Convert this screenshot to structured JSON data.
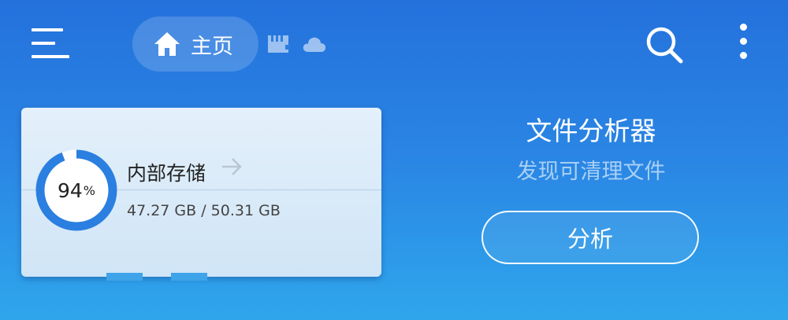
{
  "toolbar": {
    "menu_icon": "hamburger-menu-icon",
    "home_label": "主页",
    "home_icon": "home-icon",
    "storage_icon": "sd-card-icon",
    "cloud_icon": "cloud-icon",
    "search_icon": "search-icon",
    "more_icon": "more-vertical-icon"
  },
  "storage": {
    "percent": "94",
    "percent_unit": "%",
    "used_fraction": 0.94,
    "title": "内部存储",
    "size_text": "47.27 GB / 50.31 GB",
    "ring_color": "#2a7fe0"
  },
  "analyzer": {
    "title": "文件分析器",
    "subtitle": "发现可清理文件",
    "button_label": "分析"
  }
}
